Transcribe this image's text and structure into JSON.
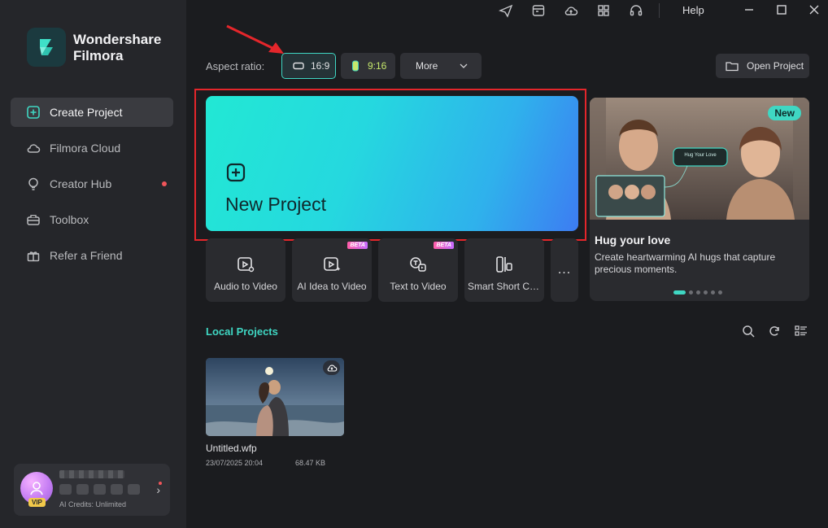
{
  "brand": {
    "line1": "Wondershare",
    "line2": "Filmora"
  },
  "sidebar": {
    "items": [
      {
        "label": "Create Project",
        "icon": "plus-square-icon",
        "active": true
      },
      {
        "label": "Filmora Cloud",
        "icon": "cloud-icon"
      },
      {
        "label": "Creator Hub",
        "icon": "bulb-icon",
        "badge_dot": true
      },
      {
        "label": "Toolbox",
        "icon": "toolbox-icon"
      },
      {
        "label": "Refer a Friend",
        "icon": "gift-icon"
      }
    ]
  },
  "account": {
    "vip_label": "VIP",
    "credits": "AI Credits: Unlimited"
  },
  "topbar": {
    "help": "Help"
  },
  "aspect": {
    "label": "Aspect ratio:",
    "options": [
      {
        "label": "16:9",
        "selected": true
      },
      {
        "label": "9:16"
      },
      {
        "label": "More"
      }
    ]
  },
  "open_project": "Open Project",
  "new_project": {
    "label": "New Project"
  },
  "tools": [
    {
      "label": "Audio to Video",
      "icon": "audio-video-icon"
    },
    {
      "label": "AI Idea to Video",
      "icon": "ai-idea-icon",
      "badge": "BETA"
    },
    {
      "label": "Text to Video",
      "icon": "text-video-icon",
      "badge": "BETA"
    },
    {
      "label": "Smart Short Cli...",
      "icon": "smart-short-icon"
    }
  ],
  "tools_more": "...",
  "promo": {
    "badge": "New",
    "title": "Hug your love",
    "description": "Create heartwarming AI hugs that capture precious moments.",
    "image_caption": "Hug Your Love",
    "slide_count": 6,
    "active_slide": 0
  },
  "local_projects": {
    "title": "Local Projects",
    "items": [
      {
        "name": "Untitled.wfp",
        "date": "23/07/2025 20:04",
        "size": "68.47 KB"
      }
    ]
  },
  "colors": {
    "accent": "#3fd7c3",
    "highlight_border": "#e4262b",
    "sidebar_bg": "#25262a",
    "main_bg": "#1b1c1f"
  }
}
